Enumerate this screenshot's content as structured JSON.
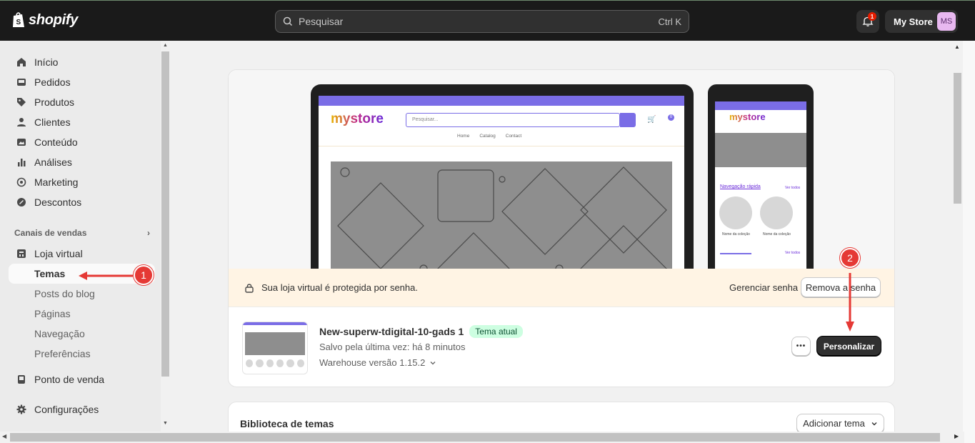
{
  "topbar": {
    "brand": "shopify",
    "search_placeholder": "Pesquisar",
    "search_shortcut": "Ctrl K",
    "notification_count": "1",
    "store_name": "My Store",
    "store_initials": "MS"
  },
  "sidebar": {
    "items": [
      {
        "label": "Início",
        "icon": "home-icon"
      },
      {
        "label": "Pedidos",
        "icon": "inbox-icon"
      },
      {
        "label": "Produtos",
        "icon": "tag-icon"
      },
      {
        "label": "Clientes",
        "icon": "person-icon"
      },
      {
        "label": "Conteúdo",
        "icon": "image-icon"
      },
      {
        "label": "Análises",
        "icon": "bar-chart-icon"
      },
      {
        "label": "Marketing",
        "icon": "target-icon"
      },
      {
        "label": "Descontos",
        "icon": "discount-icon"
      }
    ],
    "sales_channels_label": "Canais de vendas",
    "online_store": "Loja virtual",
    "sub_items": [
      "Temas",
      "Posts do blog",
      "Páginas",
      "Navegação",
      "Preferências"
    ],
    "pos": "Ponto de venda",
    "settings": "Configurações"
  },
  "annotations": {
    "one": "1",
    "two": "2",
    "color": "#e53935"
  },
  "preview": {
    "store_logo": "mystore",
    "store_search": "Pesquisar...",
    "menu": [
      "Home",
      "Catalog",
      "Contact"
    ],
    "cart_count": "0",
    "mobile_section": "Navegação rápida",
    "mobile_link": "Ver todos",
    "mobile_collection": "Nome da coleção"
  },
  "banner": {
    "text": "Sua loja virtual é protegida por senha.",
    "manage": "Gerenciar senha",
    "remove": "Remova a senha"
  },
  "theme": {
    "name": "New-superw-tdigital-10-gads 1",
    "badge": "Tema atual",
    "saved": "Salvo pela última vez: há 8 minutos",
    "version": "Warehouse versão 1.15.2",
    "more": "•••",
    "customize": "Personalizar"
  },
  "library": {
    "title": "Biblioteca de temas",
    "add": "Adicionar tema"
  }
}
